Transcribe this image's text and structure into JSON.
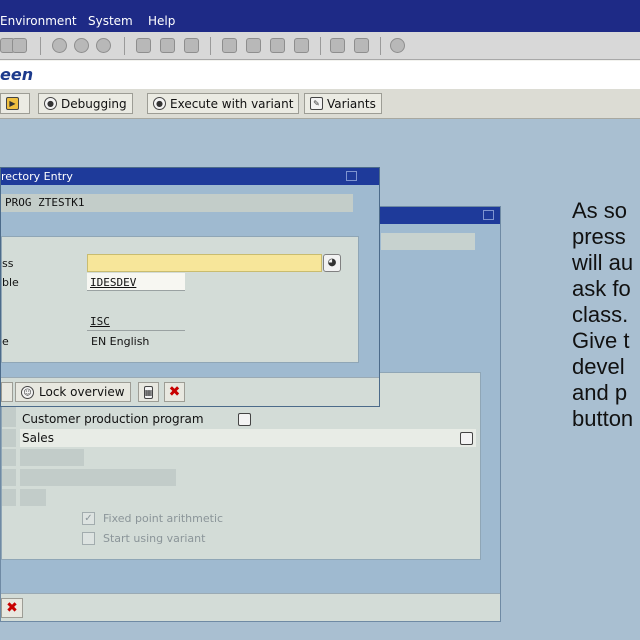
{
  "menu": {
    "items": [
      "Environment",
      "System",
      "Help"
    ]
  },
  "screen": {
    "title": "een"
  },
  "app_toolbar": {
    "debugging": "Debugging",
    "execute_variant": "Execute with variant",
    "variants": "Variants"
  },
  "dialog_front": {
    "title": "rectory Entry",
    "object_line": "PROG ZTESTK1",
    "fields": {
      "class_label": "ss",
      "table_label": "ble",
      "table_value": "IDESDEV",
      "app_value": "ISC",
      "lang_label": "e",
      "lang_value": "EN English"
    },
    "footer": {
      "lock_overview": "Lock overview"
    }
  },
  "dialog_back": {
    "rows": {
      "customer_prod": "Customer production program",
      "sales": "Sales"
    },
    "checkboxes": {
      "fixed_point": {
        "label": "Fixed point arithmetic",
        "checked": true
      },
      "start_variant": {
        "label": "Start using variant",
        "checked": false
      }
    }
  },
  "annotation": {
    "lines": [
      "As so",
      "press",
      "will au",
      "ask fo",
      "class.",
      "Give t",
      "devel",
      "and p",
      "button"
    ]
  },
  "colors": {
    "menubar": "#1e2a86",
    "dialog_title": "#1e3a9a",
    "workarea": "#a9bfd1",
    "required_field": "#f7e69a",
    "cancel": "#c80000"
  },
  "icons": {
    "debugging": "debug-icon",
    "execute_variant": "execute-variant-icon",
    "variants": "variants-icon",
    "lock_overview": "lock-overview-icon",
    "cancel": "cancel-icon"
  }
}
